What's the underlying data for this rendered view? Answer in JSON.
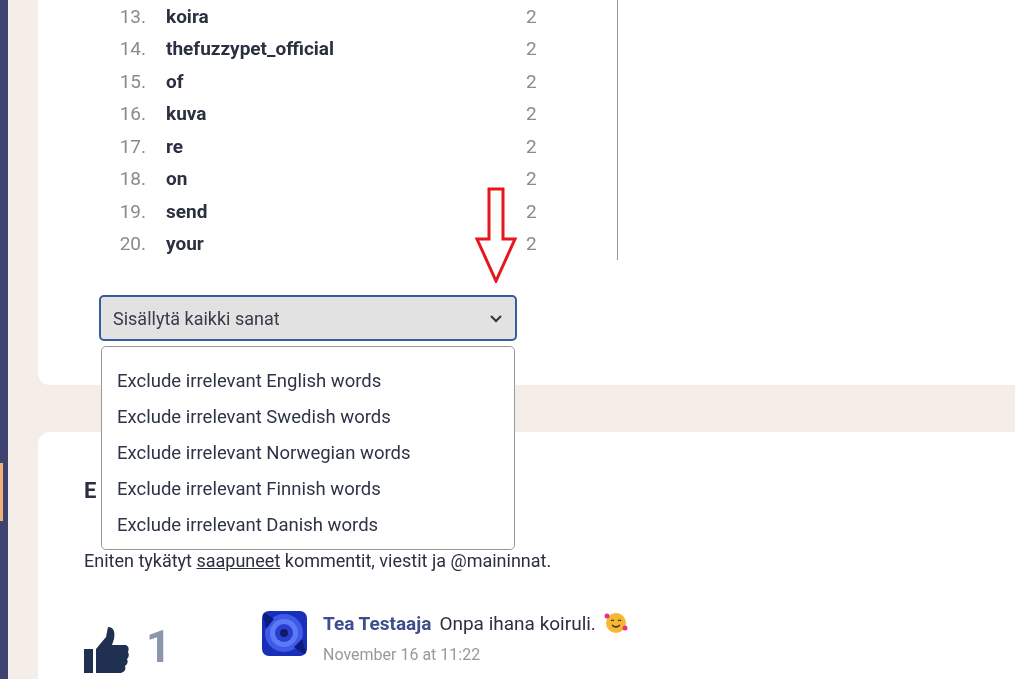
{
  "word_table": {
    "rows": [
      {
        "rank": "13.",
        "word": "koira",
        "count": "2"
      },
      {
        "rank": "14.",
        "word": "thefuzzypet_official",
        "count": "2"
      },
      {
        "rank": "15.",
        "word": "of",
        "count": "2"
      },
      {
        "rank": "16.",
        "word": "kuva",
        "count": "2"
      },
      {
        "rank": "17.",
        "word": "re",
        "count": "2"
      },
      {
        "rank": "18.",
        "word": "on",
        "count": "2"
      },
      {
        "rank": "19.",
        "word": "send",
        "count": "2"
      },
      {
        "rank": "20.",
        "word": "your",
        "count": "2"
      }
    ]
  },
  "filter_select": {
    "value": "Sisällytä kaikki sanat",
    "expanded": true,
    "options": [
      {
        "label": "Exclude irrelevant English words"
      },
      {
        "label": "Exclude irrelevant Swedish words"
      },
      {
        "label": "Exclude irrelevant Norwegian words"
      },
      {
        "label": "Exclude irrelevant Finnish words"
      },
      {
        "label": "Exclude irrelevant Danish words"
      }
    ]
  },
  "liked_section": {
    "heading": "E",
    "description": "Eniten tykätyt **saapuneet** kommentit, viestit ja @maininnat.",
    "items": [
      {
        "likes": "1",
        "author": "Tea Testaaja",
        "text": "Onpa ihana koiruli.",
        "date": "November 16 at 11:22"
      }
    ]
  }
}
